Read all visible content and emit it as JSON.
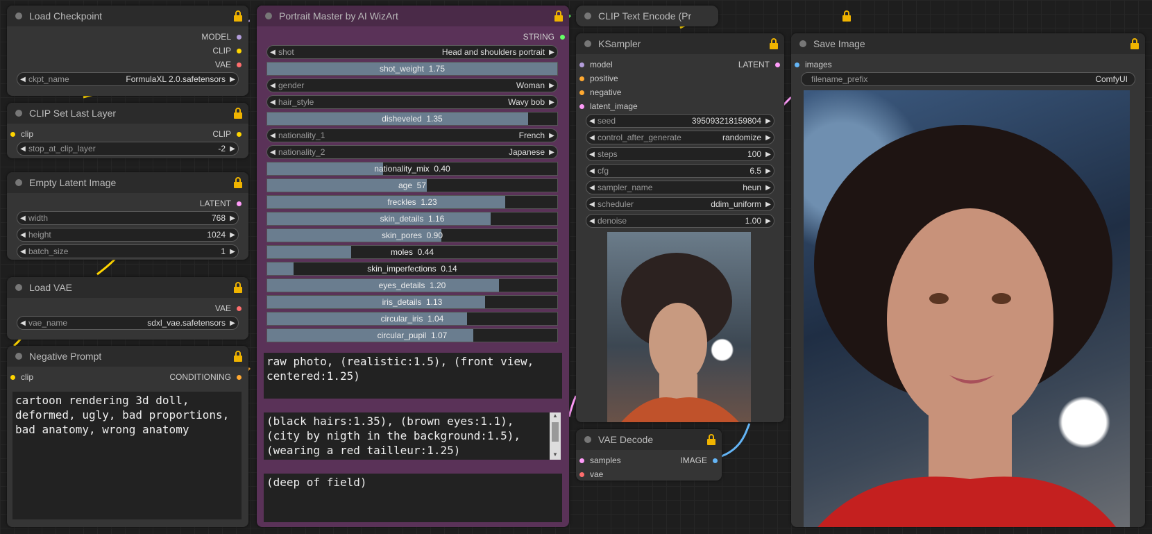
{
  "colors": {
    "model": "#b39ddb",
    "clip": "#ffd500",
    "vae": "#ff6e6e",
    "latent": "#ff9cf9",
    "conditioning": "#ffa931",
    "image": "#64b5f6",
    "string": "#66ff66"
  },
  "load_checkpoint": {
    "title": "Load Checkpoint",
    "out_model": "MODEL",
    "out_clip": "CLIP",
    "out_vae": "VAE",
    "ckpt_label": "ckpt_name",
    "ckpt_value": "FormulaXL 2.0.safetensors"
  },
  "clip_set_last_layer": {
    "title": "CLIP Set Last Layer",
    "in_clip": "clip",
    "out_clip": "CLIP",
    "stop_label": "stop_at_clip_layer",
    "stop_value": "-2"
  },
  "empty_latent": {
    "title": "Empty Latent Image",
    "out_latent": "LATENT",
    "width_label": "width",
    "width_value": "768",
    "height_label": "height",
    "height_value": "1024",
    "batch_label": "batch_size",
    "batch_value": "1"
  },
  "load_vae": {
    "title": "Load VAE",
    "out_vae": "VAE",
    "vae_label": "vae_name",
    "vae_value": "sdxl_vae.safetensors"
  },
  "negative_prompt": {
    "title": "Negative Prompt",
    "in_clip": "clip",
    "out_conditioning": "CONDITIONING",
    "text": "cartoon rendering 3d doll, deformed, ugly, bad proportions, bad anatomy, wrong anatomy"
  },
  "portrait_master": {
    "title": "Portrait Master by AI WizArt",
    "out_string": "STRING",
    "shot_label": "shot",
    "shot_value": "Head and shoulders portrait",
    "shot_weight": {
      "label": "shot_weight",
      "value": "1.75",
      "level": 1.0
    },
    "gender_label": "gender",
    "gender_value": "Woman",
    "hair_label": "hair_style",
    "hair_value": "Wavy bob",
    "disheveled": {
      "label": "disheveled",
      "value": "1.35",
      "level": 0.9
    },
    "nat1_label": "nationality_1",
    "nat1_value": "French",
    "nat2_label": "nationality_2",
    "nat2_value": "Japanese",
    "nationality_mix": {
      "label": "nationality_mix",
      "value": "0.40",
      "level": 0.4
    },
    "age": {
      "label": "age",
      "value": "57",
      "level": 0.55
    },
    "freckles": {
      "label": "freckles",
      "value": "1.23",
      "level": 0.82
    },
    "skin_details": {
      "label": "skin_details",
      "value": "1.16",
      "level": 0.77
    },
    "skin_pores": {
      "label": "skin_pores",
      "value": "0.90",
      "level": 0.6
    },
    "moles": {
      "label": "moles",
      "value": "0.44",
      "level": 0.29
    },
    "skin_imperfections": {
      "label": "skin_imperfections",
      "value": "0.14",
      "level": 0.09
    },
    "eyes_details": {
      "label": "eyes_details",
      "value": "1.20",
      "level": 0.8
    },
    "iris_details": {
      "label": "iris_details",
      "value": "1.13",
      "level": 0.75
    },
    "circular_iris": {
      "label": "circular_iris",
      "value": "1.04",
      "level": 0.69
    },
    "circular_pupil": {
      "label": "circular_pupil",
      "value": "1.07",
      "level": 0.71
    },
    "prompt_start": "raw photo, (realistic:1.5), (front view, centered:1.25)",
    "prompt_additional": "(black hairs:1.35), (brown eyes:1.1), (city by nigth in the background:1.5), (wearing a red tailleur:1.25)",
    "prompt_end": "(deep of field)"
  },
  "clip_text_encode": {
    "title": "CLIP Text Encode (Pr"
  },
  "ksampler": {
    "title": "KSampler",
    "in_model": "model",
    "in_positive": "positive",
    "in_negative": "negative",
    "in_latent": "latent_image",
    "out_latent": "LATENT",
    "seed_label": "seed",
    "seed_value": "395093218159804",
    "control_label": "control_after_generate",
    "control_value": "randomize",
    "steps_label": "steps",
    "steps_value": "100",
    "cfg_label": "cfg",
    "cfg_value": "6.5",
    "sampler_label": "sampler_name",
    "sampler_value": "heun",
    "scheduler_label": "scheduler",
    "scheduler_value": "ddim_uniform",
    "denoise_label": "denoise",
    "denoise_value": "1.00"
  },
  "vae_decode": {
    "title": "VAE Decode",
    "in_samples": "samples",
    "in_vae": "vae",
    "out_image": "IMAGE"
  },
  "save_image": {
    "title": "Save Image",
    "in_images": "images",
    "prefix_label": "filename_prefix",
    "prefix_value": "ComfyUI"
  }
}
